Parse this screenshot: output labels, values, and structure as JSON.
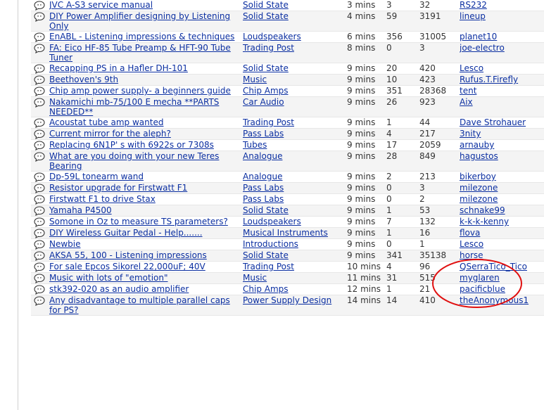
{
  "threads": [
    {
      "title": "JVC A-S3 service manual",
      "forum": "Solid State",
      "time": "3 mins",
      "replies": "3",
      "views": "32",
      "user": "RS232"
    },
    {
      "title": "DIY Power Amplifier designing by Listening Only",
      "forum": "Solid State",
      "time": "4 mins",
      "replies": "59",
      "views": "3191",
      "user": "lineup"
    },
    {
      "title": "EnABL - Listening impressions & techniques",
      "forum": "Loudspeakers",
      "time": "6 mins",
      "replies": "356",
      "views": "31005",
      "user": "planet10"
    },
    {
      "title": "FA: Eico HF-85 Tube Preamp & HFT-90 Tube Tuner",
      "forum": "Trading Post",
      "time": "8 mins",
      "replies": "0",
      "views": "3",
      "user": "joe-electro"
    },
    {
      "title": "Recapping PS in a Hafler DH-101",
      "forum": "Solid State",
      "time": "9 mins",
      "replies": "20",
      "views": "420",
      "user": "Lesco"
    },
    {
      "title": "Beethoven's 9th",
      "forum": "Music",
      "time": "9 mins",
      "replies": "10",
      "views": "423",
      "user": "Rufus.T.Firefly"
    },
    {
      "title": "Chip amp power supply- a beginners guide",
      "forum": "Chip Amps",
      "time": "9 mins",
      "replies": "351",
      "views": "28368",
      "user": "tent"
    },
    {
      "title": "Nakamichi mb-75/100 E mecha **PARTS NEEDED**",
      "forum": "Car Audio",
      "time": "9 mins",
      "replies": "26",
      "views": "923",
      "user": "Aix"
    },
    {
      "title": "Acoustat tube amp wanted",
      "forum": "Trading Post",
      "time": "9 mins",
      "replies": "1",
      "views": "44",
      "user": "Dave Strohauer"
    },
    {
      "title": "Current mirror for the aleph?",
      "forum": "Pass Labs",
      "time": "9 mins",
      "replies": "4",
      "views": "217",
      "user": "3nity"
    },
    {
      "title": "Replacing 6N1P' s with 6922s or 7308s",
      "forum": "Tubes",
      "time": "9 mins",
      "replies": "17",
      "views": "2059",
      "user": "arnauby"
    },
    {
      "title": "What are you doing with your new Teres Bearing",
      "forum": "Analogue",
      "time": "9 mins",
      "replies": "28",
      "views": "849",
      "user": "hagustos"
    },
    {
      "title": "Dp-59L tonearm wand",
      "forum": "Analogue",
      "time": "9 mins",
      "replies": "2",
      "views": "213",
      "user": "bikerboy"
    },
    {
      "title": "Resistor upgrade for Firstwatt F1",
      "forum": "Pass Labs",
      "time": "9 mins",
      "replies": "0",
      "views": "3",
      "user": "milezone"
    },
    {
      "title": "Firstwatt F1 to drive Stax",
      "forum": "Pass Labs",
      "time": "9 mins",
      "replies": "0",
      "views": "2",
      "user": "milezone"
    },
    {
      "title": "Yamaha P4500",
      "forum": "Solid State",
      "time": "9 mins",
      "replies": "1",
      "views": "53",
      "user": "schnake99"
    },
    {
      "title": "Somone in Oz to measure TS parameters?",
      "forum": "Loudspeakers",
      "time": "9 mins",
      "replies": "7",
      "views": "132",
      "user": "k-k-k-kenny"
    },
    {
      "title": "DIY Wireless Guitar Pedal - Help.......",
      "forum": "Musical Instruments",
      "time": "9 mins",
      "replies": "1",
      "views": "16",
      "user": "flova"
    },
    {
      "title": "Newbie",
      "forum": "Introductions",
      "time": "9 mins",
      "replies": "0",
      "views": "1",
      "user": "Lesco"
    },
    {
      "title": "AKSA 55, 100 - Listening impressions",
      "forum": "Solid State",
      "time": "9 mins",
      "replies": "341",
      "views": "35138",
      "user": "horse"
    },
    {
      "title": "For sale Epcos Sikorel 22,000uF; 40V",
      "forum": "Trading Post",
      "time": "10 mins",
      "replies": "4",
      "views": "96",
      "user": "QSerraTico_Tico"
    },
    {
      "title": "Music with lots of \"emotion\"",
      "forum": "Music",
      "time": "11 mins",
      "replies": "31",
      "views": "515",
      "user": "myglaren"
    },
    {
      "title": "stk392-020 as an audio amplifier",
      "forum": "Chip Amps",
      "time": "12 mins",
      "replies": "1",
      "views": "21",
      "user": "pacificblue"
    },
    {
      "title": "Any disadvantage to multiple parallel caps for PS?",
      "forum": "Power Supply Design",
      "time": "14 mins",
      "replies": "14",
      "views": "410",
      "user": "theAnonymous1"
    }
  ],
  "colors": {
    "link": "#0b2fa1",
    "shaded_row": "#f4f4f4",
    "annotation": "#e01010"
  }
}
